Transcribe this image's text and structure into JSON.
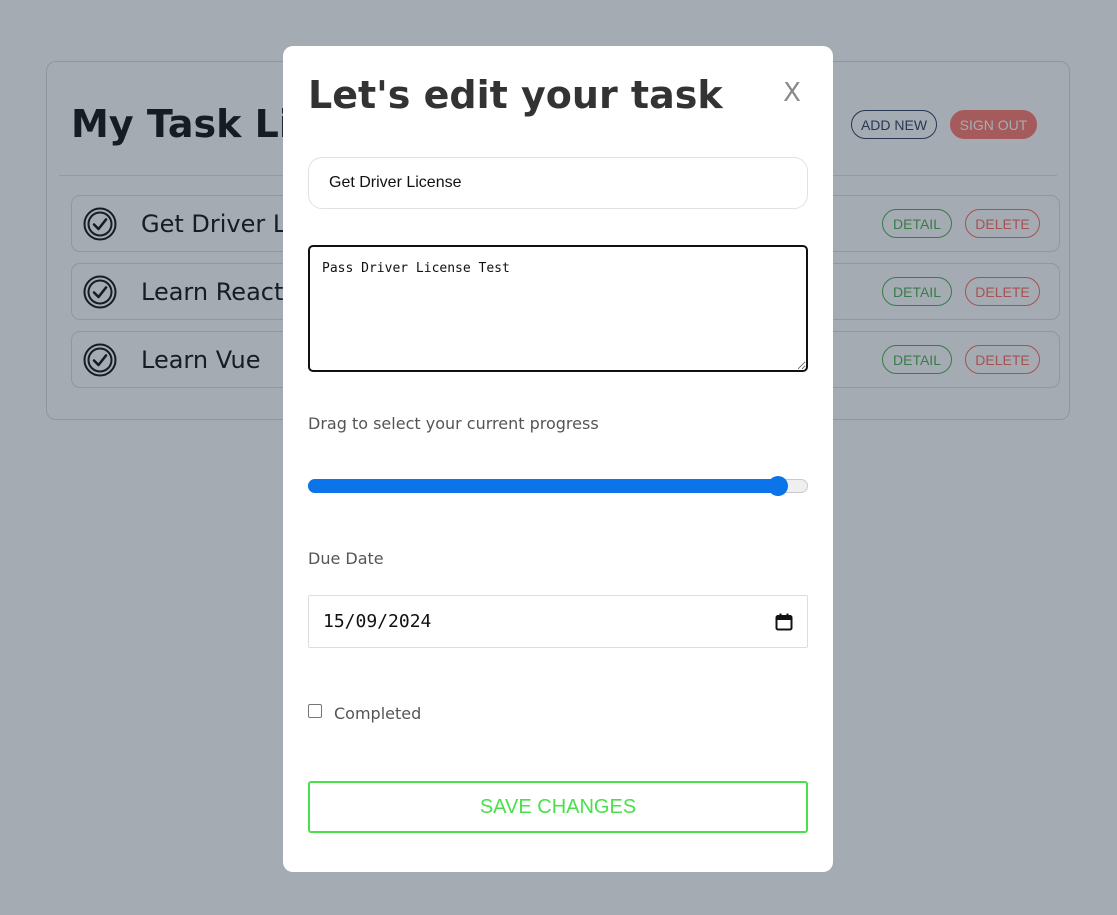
{
  "app": {
    "title": "My Task List",
    "add_new_label": "ADD NEW",
    "sign_out_label": "SIGN OUT",
    "tasks": [
      {
        "name": "Get Driver License",
        "detail_label": "DETAIL",
        "delete_label": "DELETE"
      },
      {
        "name": "Learn React",
        "detail_label": "DETAIL",
        "delete_label": "DELETE"
      },
      {
        "name": "Learn Vue",
        "detail_label": "DETAIL",
        "delete_label": "DELETE"
      }
    ]
  },
  "modal": {
    "title": "Let's edit your task",
    "close_label": "X",
    "task_title_value": "Get Driver License",
    "description_value": "Pass Driver License Test",
    "progress_label": "Drag to select your current progress",
    "progress_value": 94,
    "due_date_label": "Due Date",
    "due_date_value": "15/09/2024",
    "completed_label": "Completed",
    "completed": false,
    "save_label": "SAVE CHANGES"
  },
  "colors": {
    "accent_blue": "#0a74e8",
    "save_green": "#4ae04a",
    "detail_green": "#4caf50",
    "delete_red": "#ff6b5e",
    "sign_out_red": "#ff7a6e"
  },
  "icons": {
    "task_status": "check-circle-icon",
    "calendar": "calendar-icon"
  }
}
